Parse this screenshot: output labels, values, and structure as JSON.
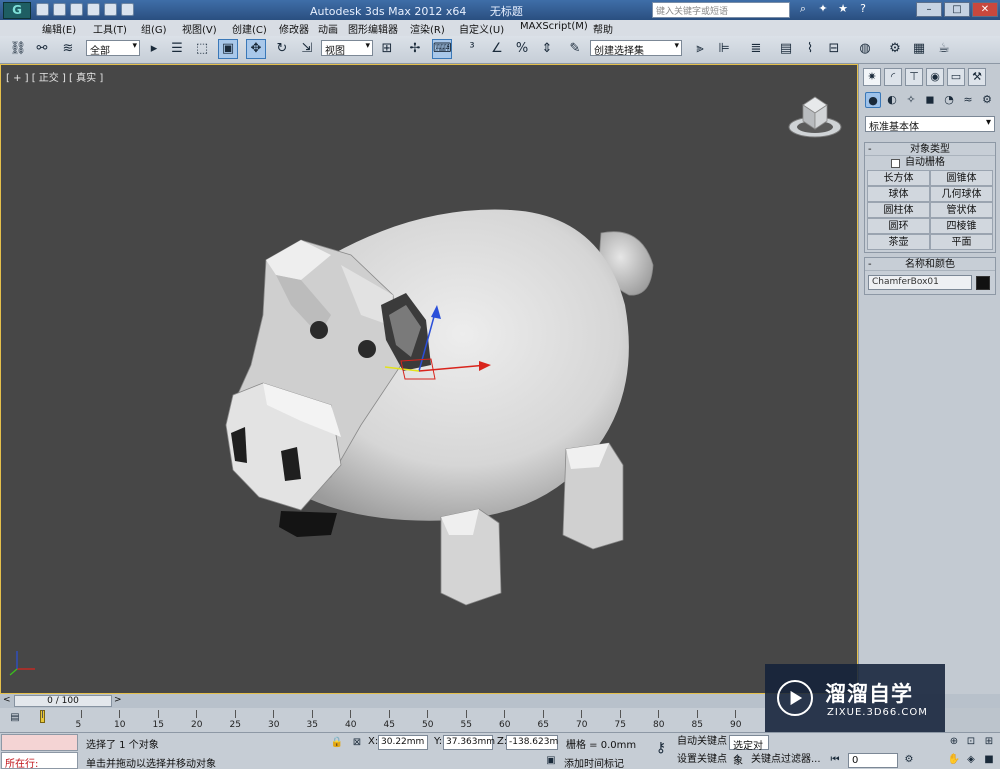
{
  "titlebar": {
    "app": "Autodesk 3ds Max  2012 x64",
    "doc": "无标题",
    "search_placeholder": "键入关键字或短语"
  },
  "menu": [
    "编辑(E)",
    "工具(T)",
    "组(G)",
    "视图(V)",
    "创建(C)",
    "修改器",
    "动画",
    "图形编辑器",
    "渲染(R)",
    "自定义(U)",
    "MAXScript(M)",
    "帮助"
  ],
  "toolbar": {
    "filter": "全部",
    "refcoord": "视图",
    "named_selection": "创建选择集"
  },
  "viewport": {
    "label": "[ + ] [ 正交 ] [ 真实 ]"
  },
  "command_panel": {
    "category": "标准基本体",
    "object_type": {
      "title": "对象类型",
      "autogrid": "自动栅格",
      "buttons": [
        "长方体",
        "圆锥体",
        "球体",
        "几何球体",
        "圆柱体",
        "管状体",
        "圆环",
        "四棱锥",
        "茶壶",
        "平面"
      ]
    },
    "name_color": {
      "title": "名称和颜色",
      "name": "ChamferBox01",
      "color": "#111111"
    }
  },
  "timeline": {
    "frame": "0 / 100",
    "ticks": [
      "0",
      "5",
      "10",
      "15",
      "20",
      "25",
      "30",
      "35",
      "40",
      "45",
      "50",
      "55",
      "60",
      "65",
      "70",
      "75",
      "80",
      "85",
      "90"
    ]
  },
  "status": {
    "listener": "所在行:",
    "selected": "选择了 1 个对象",
    "prompt": "单击并拖动以选择并移动对象",
    "x_label": "X:",
    "x": "30.22mm",
    "y_label": "Y:",
    "y": "37.363mm",
    "z_label": "Z:",
    "z": "-138.623m",
    "grid": "栅格 = 0.0mm",
    "add_time_tag": "添加时间标记",
    "auto_key": "自动关键点",
    "selected_obj": "选定对象",
    "set_key": "设置关键点",
    "key_filters": "关键点过滤器...",
    "frame_field": "0"
  },
  "watermark": {
    "title": "溜溜自学",
    "url": "ZIXUE.3D66.COM"
  }
}
